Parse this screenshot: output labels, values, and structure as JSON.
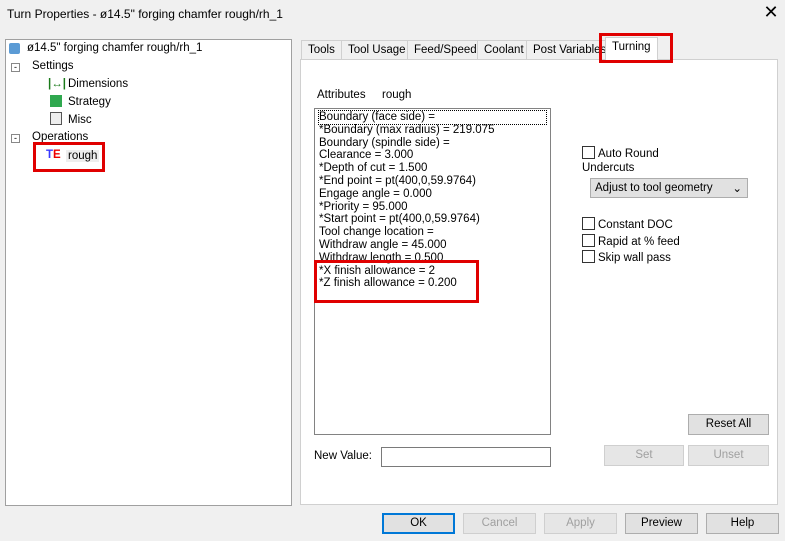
{
  "window": {
    "title": "Turn Properties - ø14.5\" forging  chamfer rough/rh_1",
    "close": "✕"
  },
  "tree": {
    "root": "ø14.5\" forging  chamfer rough/rh_1",
    "settings": "Settings",
    "dimensions": "Dimensions",
    "strategy": "Strategy",
    "misc": "Misc",
    "operations": "Operations",
    "rough": "rough"
  },
  "tabs": [
    "Tools",
    "Tool Usage",
    "Feed/Speed",
    "Coolant",
    "Post Variables",
    "Turning"
  ],
  "attributes": {
    "label": "Attributes",
    "name": "rough",
    "items": [
      " Boundary (face side) =",
      "*Boundary (max radius) = 219.075",
      " Boundary (spindle side) =",
      " Clearance = 3.000",
      "*Depth of cut = 1.500",
      "*End point = pt(400,0,59.9764)",
      " Engage angle = 0.000",
      "*Priority = 95.000",
      "*Start point = pt(400,0,59.9764)",
      " Tool change location =",
      " Withdraw angle = 45.000",
      " Withdraw length = 0.500",
      "*X finish allowance = 2",
      "*Z finish allowance = 0.200"
    ]
  },
  "options": {
    "auto_round": "Auto Round",
    "undercuts": "Undercuts",
    "undercuts_value": "Adjust to tool geometry",
    "constant_doc": "Constant DOC",
    "rapid": "Rapid at % feed",
    "skip_wall": "Skip wall pass"
  },
  "new_value": {
    "label": "New Value:",
    "value": ""
  },
  "buttons": {
    "reset_all": "Reset All",
    "set": "Set",
    "unset": "Unset",
    "ok": "OK",
    "cancel": "Cancel",
    "apply": "Apply",
    "preview": "Preview",
    "help": "Help"
  }
}
